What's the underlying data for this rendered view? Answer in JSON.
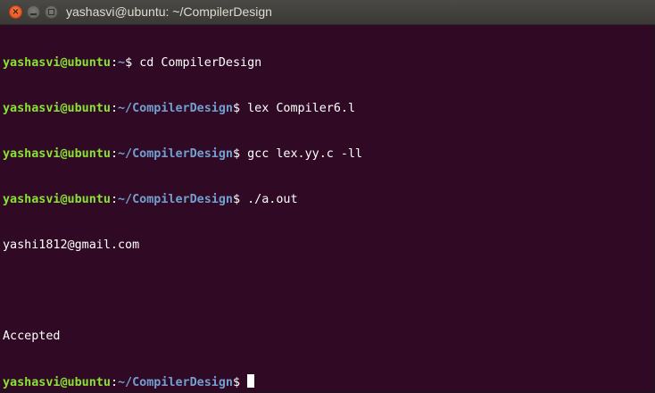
{
  "window": {
    "title": "yashasvi@ubuntu: ~/CompilerDesign",
    "close_glyph": "×",
    "accent_close": "#df4a16"
  },
  "terminal": {
    "background": "#300a24",
    "prompt_user_color": "#8ae234",
    "prompt_path_color": "#729fcf",
    "lines": [
      {
        "user": "yashasvi@ubuntu",
        "path": "~",
        "dollar": "$ ",
        "cmd": "cd CompilerDesign"
      },
      {
        "user": "yashasvi@ubuntu",
        "path": "~/CompilerDesign",
        "dollar": "$ ",
        "cmd": "lex Compiler6.l"
      },
      {
        "user": "yashasvi@ubuntu",
        "path": "~/CompilerDesign",
        "dollar": "$ ",
        "cmd": "gcc lex.yy.c -ll"
      },
      {
        "user": "yashasvi@ubuntu",
        "path": "~/CompilerDesign",
        "dollar": "$ ",
        "cmd": "./a.out"
      }
    ],
    "output": [
      "yashi1812@gmail.com",
      "",
      "Accepted"
    ],
    "final_prompt": {
      "user": "yashasvi@ubuntu",
      "path": "~/CompilerDesign",
      "dollar": "$ "
    }
  }
}
